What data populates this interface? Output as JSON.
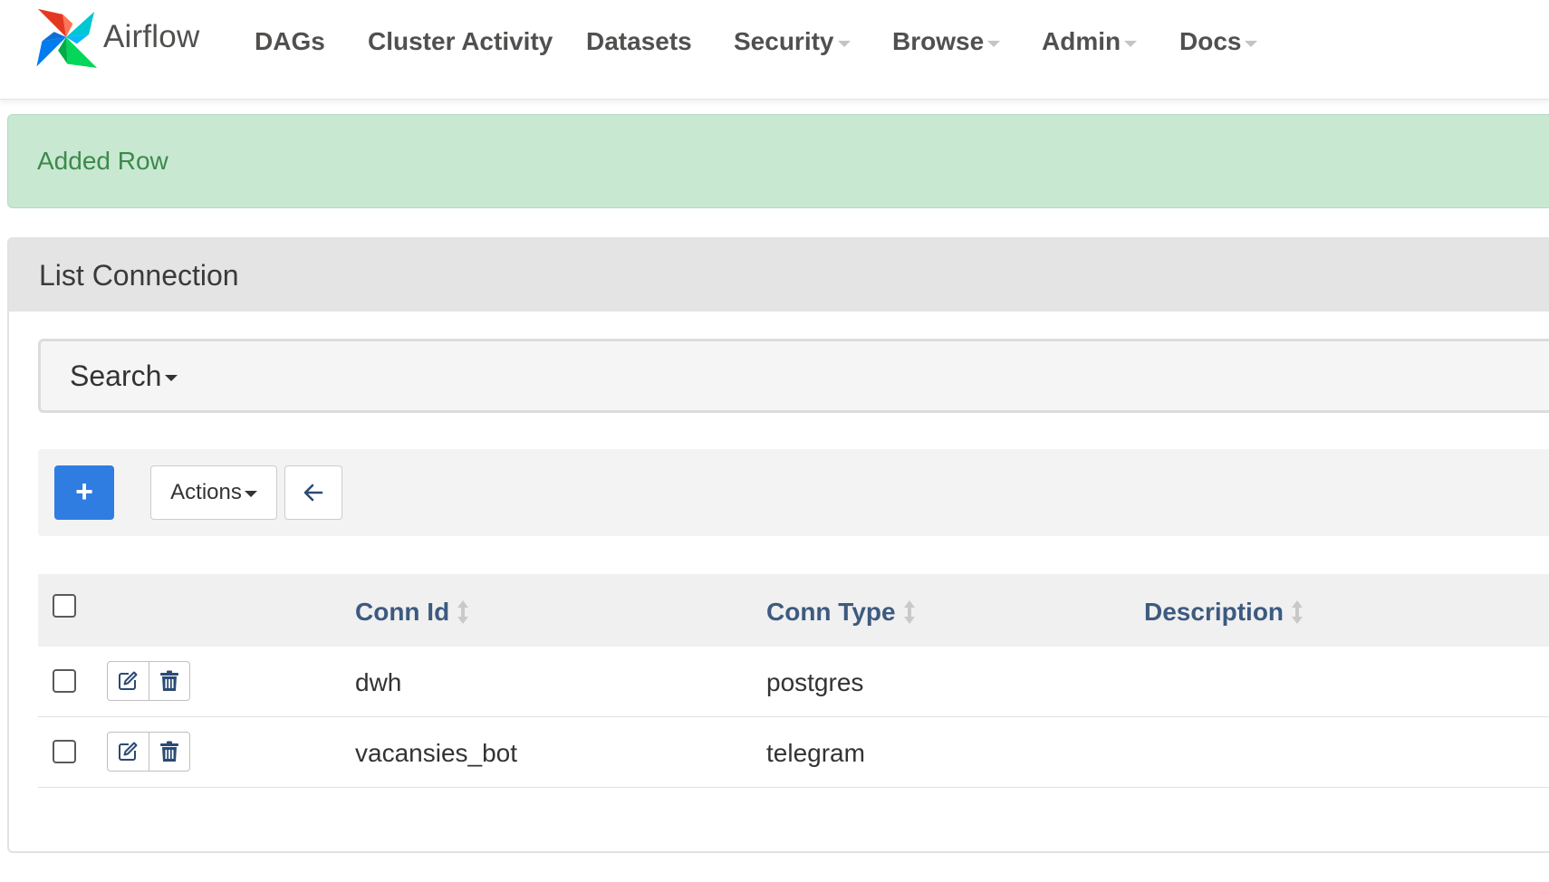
{
  "brand": {
    "name": "Airflow"
  },
  "nav": {
    "items": [
      {
        "label": "DAGs",
        "has_dropdown": false
      },
      {
        "label": "Cluster Activity",
        "has_dropdown": false
      },
      {
        "label": "Datasets",
        "has_dropdown": false
      },
      {
        "label": "Security",
        "has_dropdown": true
      },
      {
        "label": "Browse",
        "has_dropdown": true
      },
      {
        "label": "Admin",
        "has_dropdown": true
      },
      {
        "label": "Docs",
        "has_dropdown": true
      }
    ]
  },
  "alert": {
    "message": "Added Row",
    "status": "success"
  },
  "panel": {
    "title": "List Connection"
  },
  "search": {
    "label": "Search"
  },
  "toolbar": {
    "add_label": "+",
    "actions_label": "Actions"
  },
  "table": {
    "columns": [
      "Conn Id",
      "Conn Type",
      "Description"
    ],
    "rows": [
      {
        "conn_id": "dwh",
        "conn_type": "postgres",
        "description": ""
      },
      {
        "conn_id": "vacansies_bot",
        "conn_type": "telegram",
        "description": ""
      }
    ]
  },
  "colors": {
    "accent": "#2f7de1",
    "header_text": "#3d5a80",
    "alert_bg": "#c8e8d2",
    "alert_text": "#3c8a4a"
  }
}
